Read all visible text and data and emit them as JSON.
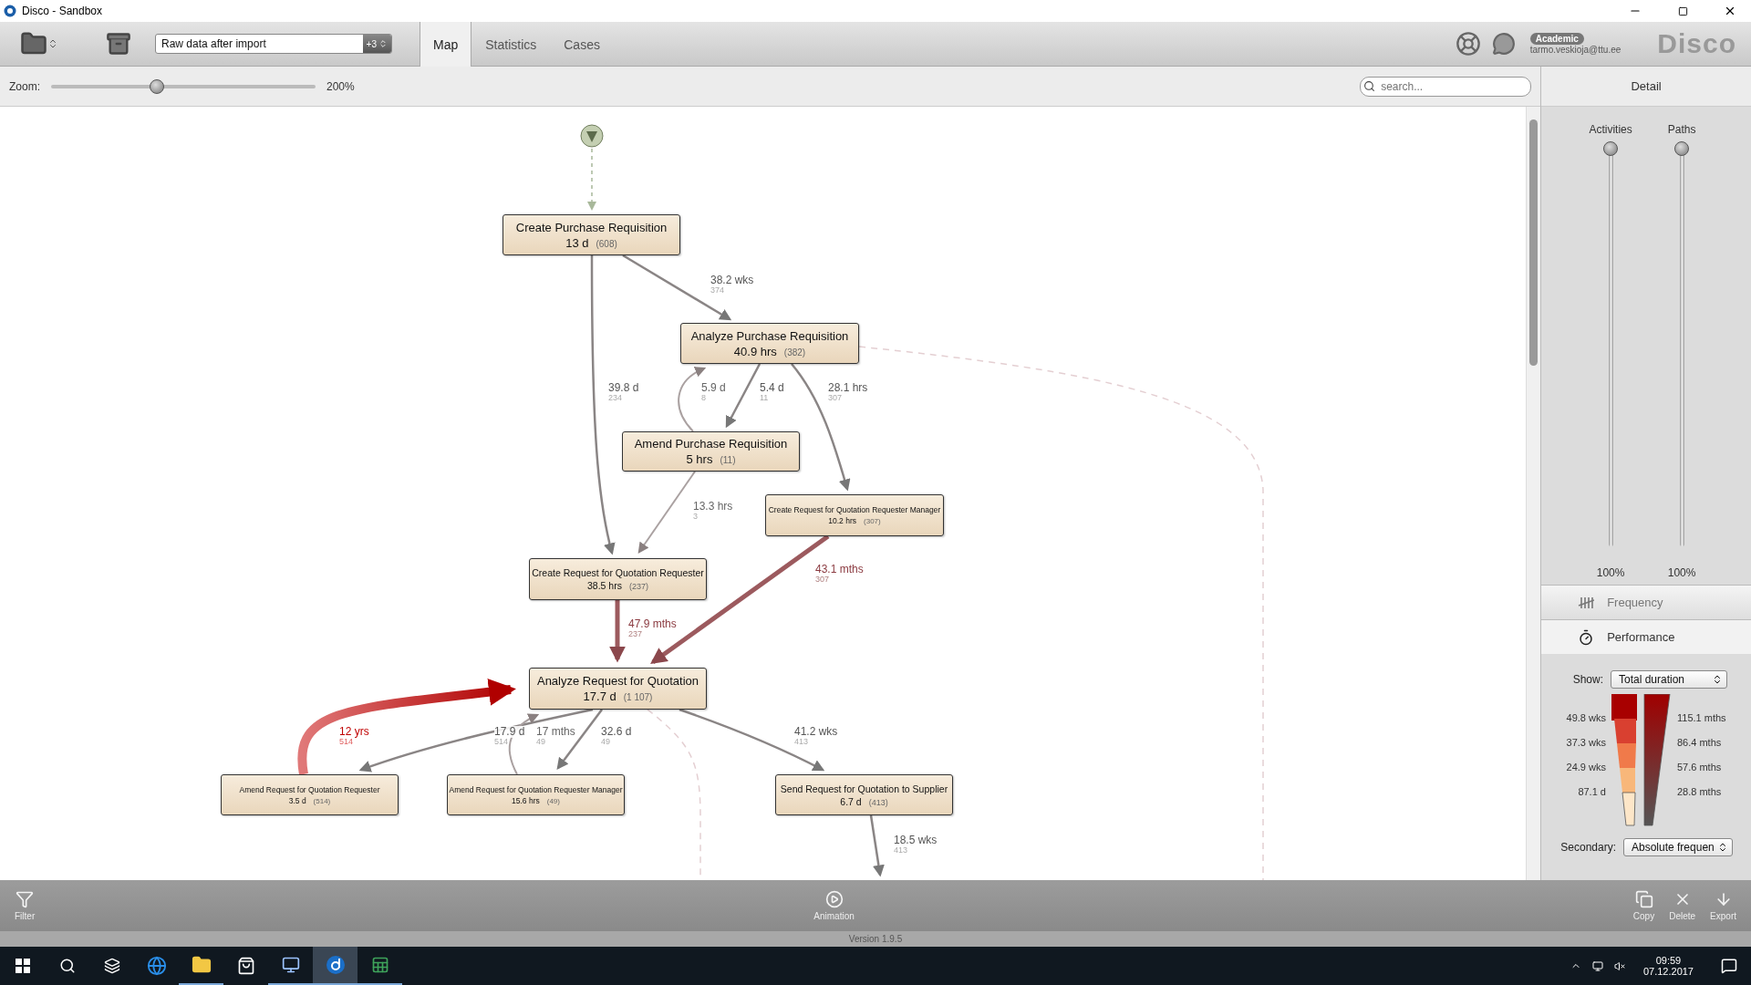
{
  "window": {
    "title": "Disco - Sandbox"
  },
  "toolbar": {
    "dataset": "Raw data after import",
    "dataset_badge": "+3",
    "tabs": [
      {
        "label": "Map",
        "selected": true
      },
      {
        "label": "Statistics",
        "selected": false
      },
      {
        "label": "Cases",
        "selected": false
      }
    ],
    "account_badge": "Academic",
    "account_email": "tarmo.veskioja@ttu.ee",
    "logo": "Disco"
  },
  "zoom": {
    "label": "Zoom:",
    "level": 0.4,
    "reading": "200%"
  },
  "search": {
    "placeholder": "search..."
  },
  "map": {
    "nodes": [
      {
        "name": "Create Purchase Requisition",
        "duration": "13 d",
        "count": "(608)",
        "kind": "large"
      },
      {
        "name": "Analyze Purchase Requisition",
        "duration": "40.9 hrs",
        "count": "(382)",
        "kind": "large"
      },
      {
        "name": "Amend Purchase Requisition",
        "duration": "5 hrs",
        "count": "(11)",
        "kind": "large"
      },
      {
        "name": "Create Request for Quotation Requester Manager",
        "duration": "10.2 hrs",
        "count": "(307)",
        "kind": "small"
      },
      {
        "name": "Create Request for Quotation Requester",
        "duration": "38.5 hrs",
        "count": "(237)",
        "kind": "medium"
      },
      {
        "name": "Analyze Request for Quotation",
        "duration": "17.7 d",
        "count": "(1 107)",
        "kind": "large"
      },
      {
        "name": "Amend Request for Quotation Requester",
        "duration": "3.5 d",
        "count": "(514)",
        "kind": "small"
      },
      {
        "name": "Amend Request for Quotation Requester Manager",
        "duration": "15.6 hrs",
        "count": "(49)",
        "kind": "small"
      },
      {
        "name": "Send Request for Quotation to Supplier",
        "duration": "6.7 d",
        "count": "(413)",
        "kind": "medium"
      }
    ],
    "edges": [
      {
        "kind": "start"
      },
      {
        "kind": "grey",
        "duration": "38.2 wks",
        "count": "374"
      },
      {
        "kind": "grey",
        "duration": "39.8 d",
        "count": "234"
      },
      {
        "kind": "light",
        "duration": "5.9 d",
        "count": "8"
      },
      {
        "kind": "grey",
        "duration": "5.4 d",
        "count": "11"
      },
      {
        "kind": "grey",
        "duration": "28.1 hrs",
        "count": "307"
      },
      {
        "kind": "light",
        "duration": "13.3 hrs",
        "count": "3"
      },
      {
        "kind": "brown",
        "duration": "43.1 mths",
        "count": "307"
      },
      {
        "kind": "brown",
        "duration": "47.9 mths",
        "count": "237"
      },
      {
        "kind": "red",
        "duration": "12 yrs",
        "count": "514"
      },
      {
        "kind": "grey",
        "duration": "17.9 d",
        "count": "514"
      },
      {
        "kind": "light",
        "duration": "17 mths",
        "count": "49"
      },
      {
        "kind": "grey",
        "duration": "32.6 d",
        "count": "49"
      },
      {
        "kind": "grey",
        "duration": "41.2 wks",
        "count": "413"
      },
      {
        "kind": "grey",
        "duration": "18.5 wks",
        "count": "413"
      },
      {
        "kind": "dashed"
      },
      {
        "kind": "dashed"
      }
    ]
  },
  "detail": {
    "title": "Detail",
    "sliders": [
      {
        "label": "Activities",
        "level": 1,
        "reading": "100%"
      },
      {
        "label": "Paths",
        "level": 1,
        "reading": "100%"
      }
    ],
    "modes": [
      {
        "label": "Frequency",
        "kind": "tally",
        "selected": false
      },
      {
        "label": "Performance",
        "kind": "stopwatch",
        "selected": true
      }
    ],
    "show_label": "Show:",
    "show_value": "Total duration",
    "legend_left": [
      "49.8 wks",
      "37.3 wks",
      "24.9 wks",
      "87.1 d"
    ],
    "legend_right": [
      "115.1 mths",
      "86.4 mths",
      "57.6 mths",
      "28.8 mths"
    ],
    "secondary_label": "Secondary:",
    "secondary_value": "Absolute frequen"
  },
  "bottom": {
    "left": [
      {
        "label": "Filter",
        "kind": "filter"
      }
    ],
    "center": [
      {
        "label": "Animation",
        "kind": "play"
      }
    ],
    "right": [
      {
        "label": "Copy",
        "kind": "copy"
      },
      {
        "label": "Delete",
        "kind": "delete"
      },
      {
        "label": "Export",
        "kind": "export"
      }
    ],
    "version": "Version 1.9.5"
  },
  "taskbar": {
    "time": "09:59",
    "date": "07.12.2017"
  }
}
